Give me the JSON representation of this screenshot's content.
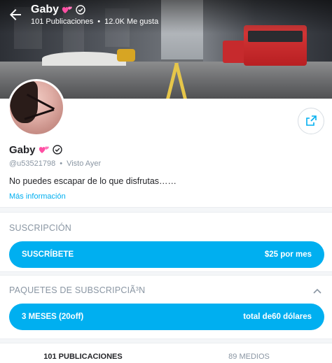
{
  "header": {
    "name": "Gaby",
    "posts_count": "101 Publicaciones",
    "separator": "•",
    "likes_count": "12.0K Me gusta"
  },
  "icons": {
    "back": "arrow-left-icon",
    "heart": "two-hearts-emoji",
    "verified": "verified-badge-icon",
    "share": "share-icon",
    "collapse": "chevron-up-icon"
  },
  "profile": {
    "name": "Gaby",
    "handle": "@u53521798",
    "separator": "•",
    "last_seen": "Visto Ayer",
    "bio": "No puedes escapar de lo que disfrutas……",
    "more_info": "Más información"
  },
  "subscription": {
    "title": "SUSCRIPCIÓN",
    "button_label": "SUSCRÍBETE",
    "button_price": "$25 por mes"
  },
  "bundles": {
    "title": "PAQUETES DE SUBSCRIPCIÃ³N",
    "bundle_label": "3 MESES (20off)",
    "bundle_price": "total de60 dólares"
  },
  "tabs": [
    {
      "label": "101 PUBLICACIONES",
      "active": true
    },
    {
      "label": "89 MEDIOS",
      "active": false
    }
  ],
  "colors": {
    "accent": "#00aff0",
    "text": "#242529",
    "muted": "#8a96a3",
    "heart": "#ff4fa3"
  }
}
